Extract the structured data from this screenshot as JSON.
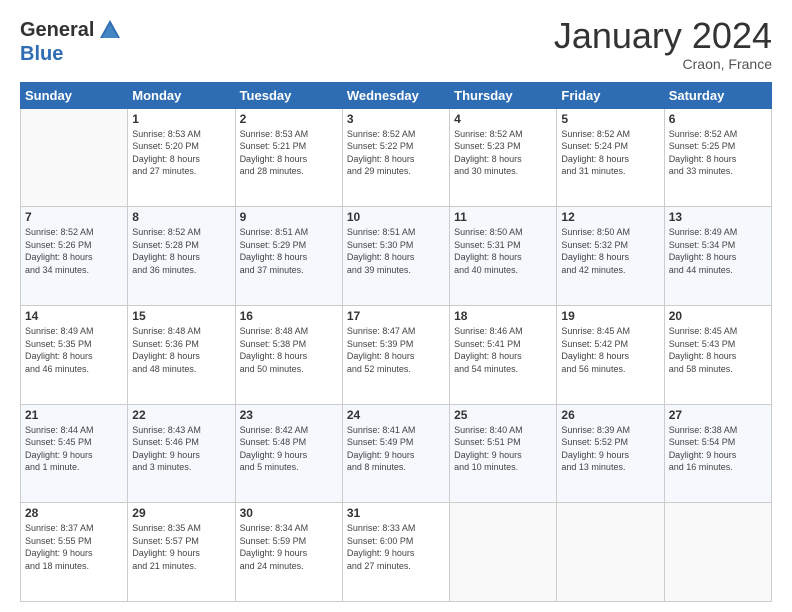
{
  "header": {
    "logo_line1": "General",
    "logo_line2": "Blue",
    "month": "January 2024",
    "location": "Craon, France"
  },
  "weekdays": [
    "Sunday",
    "Monday",
    "Tuesday",
    "Wednesday",
    "Thursday",
    "Friday",
    "Saturday"
  ],
  "weeks": [
    [
      {
        "day": "",
        "info": ""
      },
      {
        "day": "1",
        "info": "Sunrise: 8:53 AM\nSunset: 5:20 PM\nDaylight: 8 hours\nand 27 minutes."
      },
      {
        "day": "2",
        "info": "Sunrise: 8:53 AM\nSunset: 5:21 PM\nDaylight: 8 hours\nand 28 minutes."
      },
      {
        "day": "3",
        "info": "Sunrise: 8:52 AM\nSunset: 5:22 PM\nDaylight: 8 hours\nand 29 minutes."
      },
      {
        "day": "4",
        "info": "Sunrise: 8:52 AM\nSunset: 5:23 PM\nDaylight: 8 hours\nand 30 minutes."
      },
      {
        "day": "5",
        "info": "Sunrise: 8:52 AM\nSunset: 5:24 PM\nDaylight: 8 hours\nand 31 minutes."
      },
      {
        "day": "6",
        "info": "Sunrise: 8:52 AM\nSunset: 5:25 PM\nDaylight: 8 hours\nand 33 minutes."
      }
    ],
    [
      {
        "day": "7",
        "info": "Sunrise: 8:52 AM\nSunset: 5:26 PM\nDaylight: 8 hours\nand 34 minutes."
      },
      {
        "day": "8",
        "info": "Sunrise: 8:52 AM\nSunset: 5:28 PM\nDaylight: 8 hours\nand 36 minutes."
      },
      {
        "day": "9",
        "info": "Sunrise: 8:51 AM\nSunset: 5:29 PM\nDaylight: 8 hours\nand 37 minutes."
      },
      {
        "day": "10",
        "info": "Sunrise: 8:51 AM\nSunset: 5:30 PM\nDaylight: 8 hours\nand 39 minutes."
      },
      {
        "day": "11",
        "info": "Sunrise: 8:50 AM\nSunset: 5:31 PM\nDaylight: 8 hours\nand 40 minutes."
      },
      {
        "day": "12",
        "info": "Sunrise: 8:50 AM\nSunset: 5:32 PM\nDaylight: 8 hours\nand 42 minutes."
      },
      {
        "day": "13",
        "info": "Sunrise: 8:49 AM\nSunset: 5:34 PM\nDaylight: 8 hours\nand 44 minutes."
      }
    ],
    [
      {
        "day": "14",
        "info": "Sunrise: 8:49 AM\nSunset: 5:35 PM\nDaylight: 8 hours\nand 46 minutes."
      },
      {
        "day": "15",
        "info": "Sunrise: 8:48 AM\nSunset: 5:36 PM\nDaylight: 8 hours\nand 48 minutes."
      },
      {
        "day": "16",
        "info": "Sunrise: 8:48 AM\nSunset: 5:38 PM\nDaylight: 8 hours\nand 50 minutes."
      },
      {
        "day": "17",
        "info": "Sunrise: 8:47 AM\nSunset: 5:39 PM\nDaylight: 8 hours\nand 52 minutes."
      },
      {
        "day": "18",
        "info": "Sunrise: 8:46 AM\nSunset: 5:41 PM\nDaylight: 8 hours\nand 54 minutes."
      },
      {
        "day": "19",
        "info": "Sunrise: 8:45 AM\nSunset: 5:42 PM\nDaylight: 8 hours\nand 56 minutes."
      },
      {
        "day": "20",
        "info": "Sunrise: 8:45 AM\nSunset: 5:43 PM\nDaylight: 8 hours\nand 58 minutes."
      }
    ],
    [
      {
        "day": "21",
        "info": "Sunrise: 8:44 AM\nSunset: 5:45 PM\nDaylight: 9 hours\nand 1 minute."
      },
      {
        "day": "22",
        "info": "Sunrise: 8:43 AM\nSunset: 5:46 PM\nDaylight: 9 hours\nand 3 minutes."
      },
      {
        "day": "23",
        "info": "Sunrise: 8:42 AM\nSunset: 5:48 PM\nDaylight: 9 hours\nand 5 minutes."
      },
      {
        "day": "24",
        "info": "Sunrise: 8:41 AM\nSunset: 5:49 PM\nDaylight: 9 hours\nand 8 minutes."
      },
      {
        "day": "25",
        "info": "Sunrise: 8:40 AM\nSunset: 5:51 PM\nDaylight: 9 hours\nand 10 minutes."
      },
      {
        "day": "26",
        "info": "Sunrise: 8:39 AM\nSunset: 5:52 PM\nDaylight: 9 hours\nand 13 minutes."
      },
      {
        "day": "27",
        "info": "Sunrise: 8:38 AM\nSunset: 5:54 PM\nDaylight: 9 hours\nand 16 minutes."
      }
    ],
    [
      {
        "day": "28",
        "info": "Sunrise: 8:37 AM\nSunset: 5:55 PM\nDaylight: 9 hours\nand 18 minutes."
      },
      {
        "day": "29",
        "info": "Sunrise: 8:35 AM\nSunset: 5:57 PM\nDaylight: 9 hours\nand 21 minutes."
      },
      {
        "day": "30",
        "info": "Sunrise: 8:34 AM\nSunset: 5:59 PM\nDaylight: 9 hours\nand 24 minutes."
      },
      {
        "day": "31",
        "info": "Sunrise: 8:33 AM\nSunset: 6:00 PM\nDaylight: 9 hours\nand 27 minutes."
      },
      {
        "day": "",
        "info": ""
      },
      {
        "day": "",
        "info": ""
      },
      {
        "day": "",
        "info": ""
      }
    ]
  ]
}
